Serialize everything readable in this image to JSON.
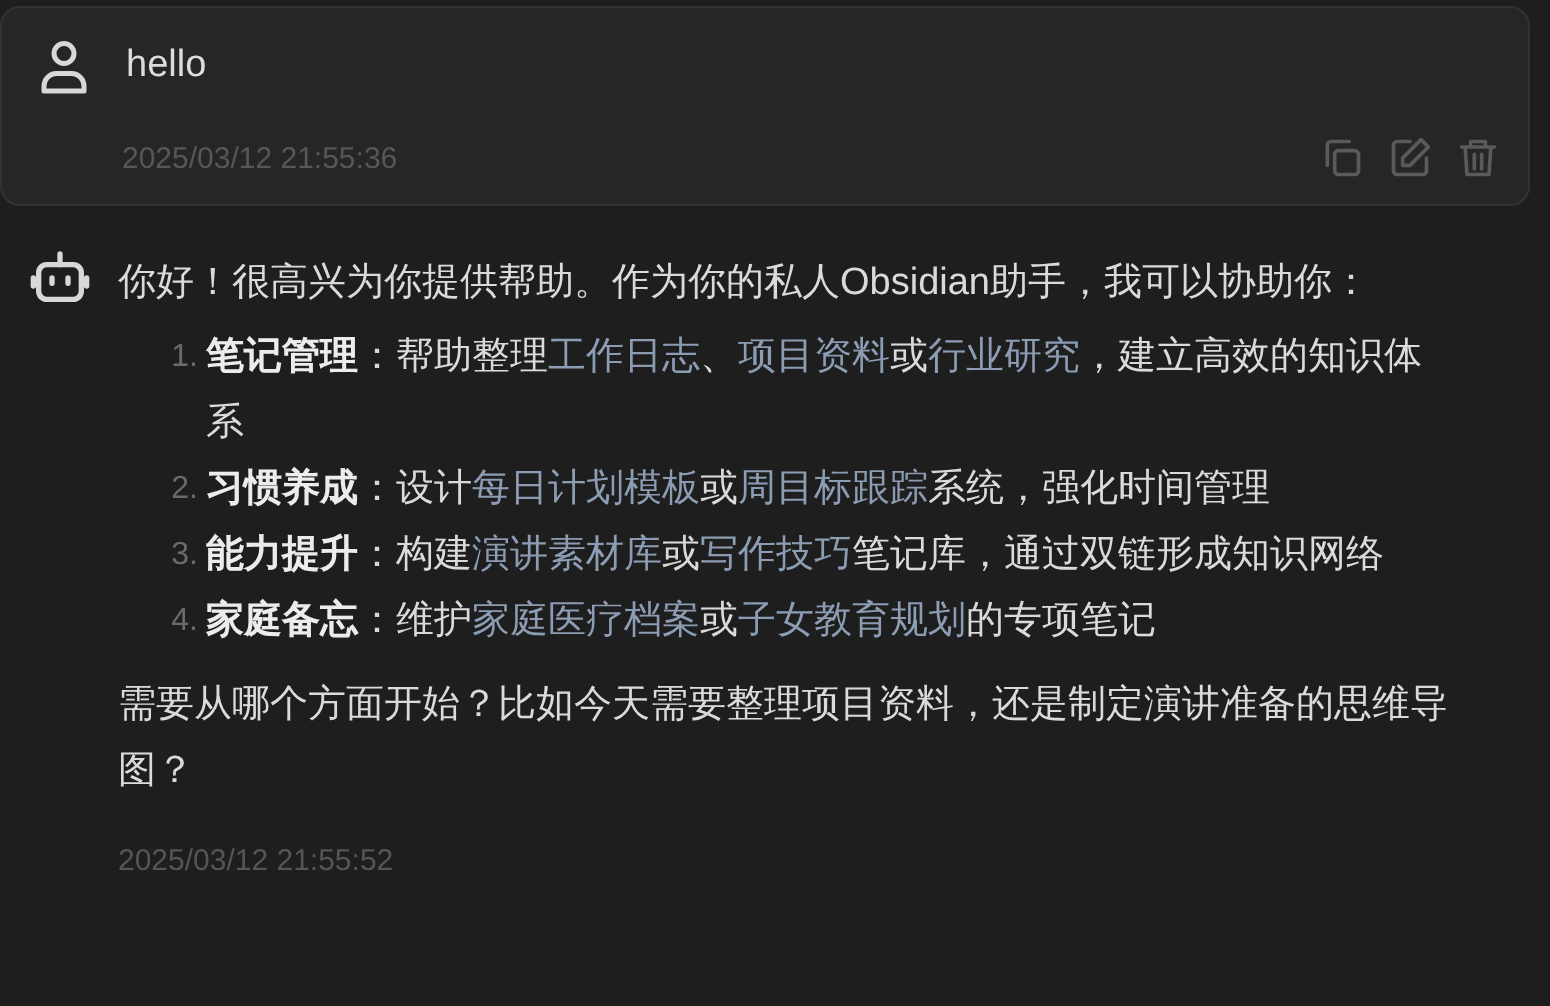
{
  "user_message": {
    "text": "hello",
    "timestamp": "2025/03/12 21:55:36"
  },
  "assistant_message": {
    "intro": "你好！很高兴为你提供帮助。作为你的私人Obsidian助手，我可以协助你：",
    "items": [
      {
        "number": "1.",
        "title": "笔记管理",
        "parts": [
          {
            "kind": "plain",
            "text": "：帮助整理"
          },
          {
            "kind": "link",
            "text": "工作日志"
          },
          {
            "kind": "plain",
            "text": "、"
          },
          {
            "kind": "link",
            "text": "项目资料"
          },
          {
            "kind": "plain",
            "text": "或"
          },
          {
            "kind": "link",
            "text": "行业研究"
          },
          {
            "kind": "plain",
            "text": "，建立高效的知识体系"
          }
        ]
      },
      {
        "number": "2.",
        "title": "习惯养成",
        "parts": [
          {
            "kind": "plain",
            "text": "：设计"
          },
          {
            "kind": "link",
            "text": "每日计划模板"
          },
          {
            "kind": "plain",
            "text": "或"
          },
          {
            "kind": "link",
            "text": "周目标跟踪"
          },
          {
            "kind": "plain",
            "text": "系统，强化时间管理"
          }
        ]
      },
      {
        "number": "3.",
        "title": "能力提升",
        "parts": [
          {
            "kind": "plain",
            "text": "：构建"
          },
          {
            "kind": "link",
            "text": "演讲素材库"
          },
          {
            "kind": "plain",
            "text": "或"
          },
          {
            "kind": "link",
            "text": "写作技巧"
          },
          {
            "kind": "plain",
            "text": "笔记库，通过双链形成知识网络"
          }
        ]
      },
      {
        "number": "4.",
        "title": "家庭备忘",
        "parts": [
          {
            "kind": "plain",
            "text": "：维护"
          },
          {
            "kind": "link",
            "text": "家庭医疗档案"
          },
          {
            "kind": "plain",
            "text": "或"
          },
          {
            "kind": "link",
            "text": "子女教育规划"
          },
          {
            "kind": "plain",
            "text": "的专项笔记"
          }
        ]
      }
    ],
    "closing": "需要从哪个方面开始？比如今天需要整理项目资料，还是制定演讲准备的思维导图？",
    "timestamp": "2025/03/12 21:55:52"
  }
}
